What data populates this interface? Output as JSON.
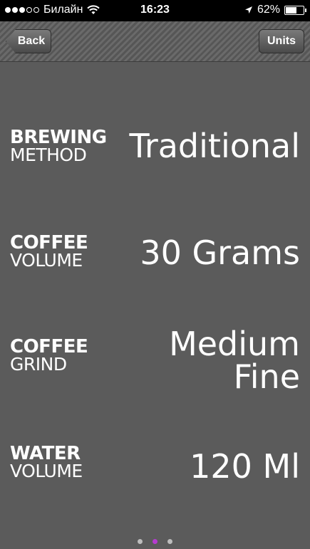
{
  "status_bar": {
    "carrier": "Билайн",
    "time": "16:23",
    "battery": "62%",
    "battery_level": 0.62
  },
  "nav": {
    "back_label": "Back",
    "units_label": "Units"
  },
  "settings": [
    {
      "label_top": "BREWING",
      "label_bottom": "METHOD",
      "value": "Traditional"
    },
    {
      "label_top": "COFFEE",
      "label_bottom": "VOLUME",
      "value": "30 Grams"
    },
    {
      "label_top": "COFFEE",
      "label_bottom": "GRIND",
      "value": "Medium Fine"
    },
    {
      "label_top": "WATER",
      "label_bottom": "VOLUME",
      "value": "120 Ml"
    }
  ],
  "pager": {
    "pages": 3,
    "current": 2
  }
}
